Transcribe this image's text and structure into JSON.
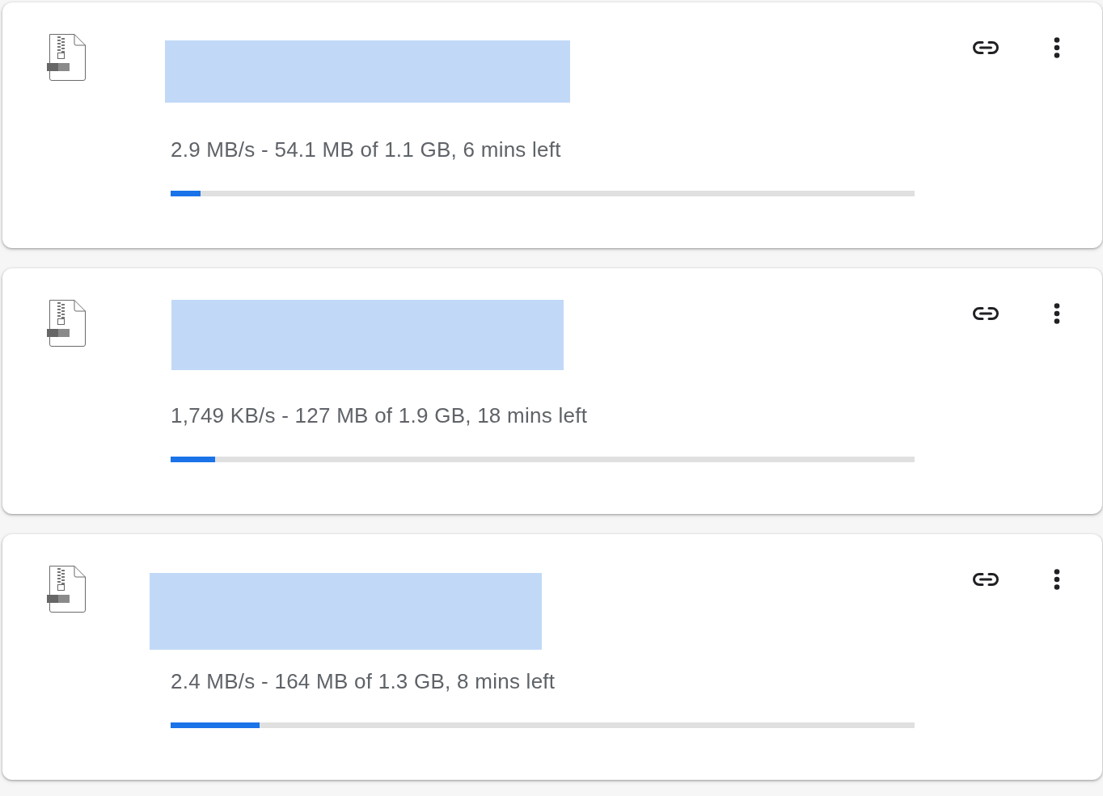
{
  "downloads": [
    {
      "status": "2.9 MB/s - 54.1 MB of 1.1 GB, 6 mins left",
      "level": 0.04
    },
    {
      "status": "1,749 KB/s - 127 MB of 1.9 GB, 18 mins left",
      "level": 0.06
    },
    {
      "status": "2.4 MB/s - 164 MB of 1.3 GB, 8 mins left",
      "level": 0.12
    }
  ]
}
